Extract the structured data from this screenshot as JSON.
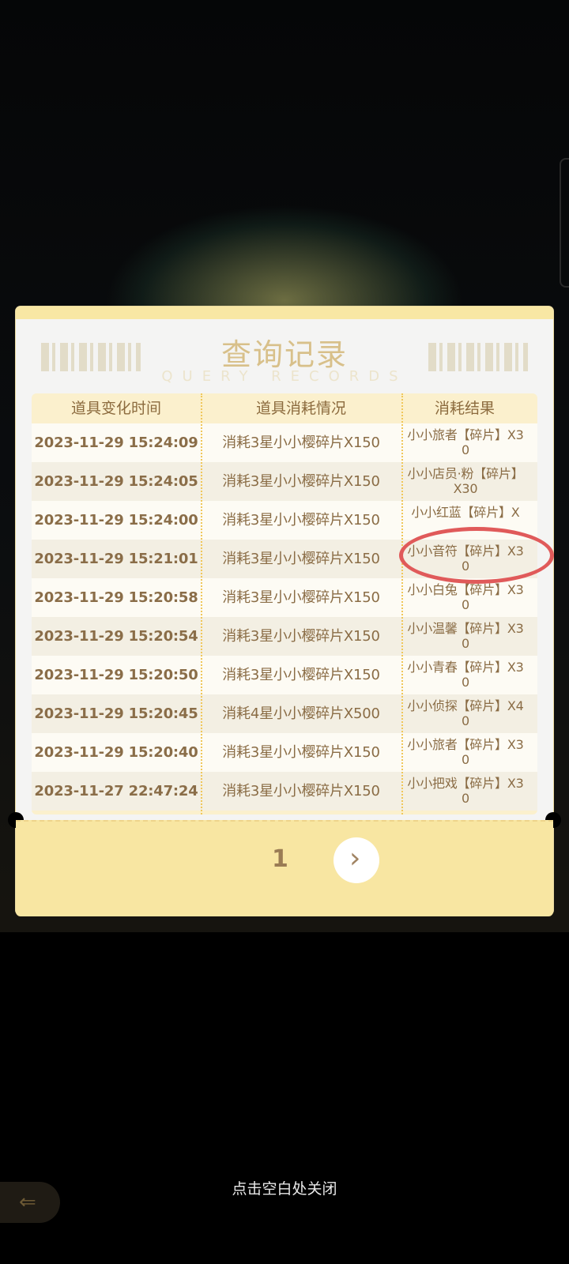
{
  "dialog": {
    "title": "查询记录",
    "subtitle": "QUERY RECORDS",
    "columns": [
      "道具变化时间",
      "道具消耗情况",
      "消耗结果"
    ],
    "rows": [
      {
        "time": "2023-11-29 15:24:09",
        "consume": "消耗3星小小樱碎片X150",
        "result": "小小旅者【碎片】X30"
      },
      {
        "time": "2023-11-29 15:24:05",
        "consume": "消耗3星小小樱碎片X150",
        "result": "小小店员·粉【碎片】X30"
      },
      {
        "time": "2023-11-29 15:24:00",
        "consume": "消耗3星小小樱碎片X150",
        "result": "小小红蓝【碎片】X"
      },
      {
        "time": "2023-11-29 15:21:01",
        "consume": "消耗3星小小樱碎片X150",
        "result": "小小音符【碎片】X30"
      },
      {
        "time": "2023-11-29 15:20:58",
        "consume": "消耗3星小小樱碎片X150",
        "result": "小小白兔【碎片】X30"
      },
      {
        "time": "2023-11-29 15:20:54",
        "consume": "消耗3星小小樱碎片X150",
        "result": "小小温馨【碎片】X30"
      },
      {
        "time": "2023-11-29 15:20:50",
        "consume": "消耗3星小小樱碎片X150",
        "result": "小小青春【碎片】X30"
      },
      {
        "time": "2023-11-29 15:20:45",
        "consume": "消耗4星小小樱碎片X500",
        "result": "小小侦探【碎片】X40"
      },
      {
        "time": "2023-11-29 15:20:40",
        "consume": "消耗3星小小樱碎片X150",
        "result": "小小旅者【碎片】X30"
      },
      {
        "time": "2023-11-27 22:47:24",
        "consume": "消耗3星小小樱碎片X150",
        "result": "小小把戏【碎片】X30"
      }
    ],
    "pagination": {
      "page": "1",
      "next_icon": "chevron-right-icon"
    }
  },
  "close_hint": "点击空白处关闭",
  "colors": {
    "accent": "#f8e6a2",
    "text": "#8a6c45",
    "highlight": "#e05a5a"
  }
}
